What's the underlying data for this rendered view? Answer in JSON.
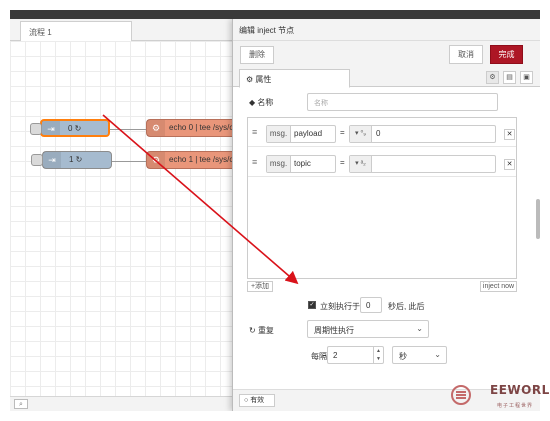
{
  "workspace": {
    "tab_label": "流程 1",
    "search_icon": "search-icon",
    "nodes": [
      {
        "label": "0 ↻",
        "type": "inject",
        "selected": true
      },
      {
        "label": "1 ↻",
        "type": "inject",
        "selected": false
      },
      {
        "label": "echo 0 | tee /sys/c",
        "type": "exec"
      },
      {
        "label": "echo 1 | tee /sys/c",
        "type": "exec"
      }
    ]
  },
  "tray": {
    "title": "编辑 inject 节点",
    "delete_label": "删除",
    "cancel_label": "取消",
    "done_label": "完成",
    "tab_properties": "属性",
    "name_label": "名称",
    "name_placeholder": "名称",
    "props": [
      {
        "msg_prefix": "msg.",
        "key": "payload",
        "op": "=",
        "type_icon": "⁰₉",
        "value": "0"
      },
      {
        "msg_prefix": "msg.",
        "key": "topic",
        "op": "=",
        "type_icon": "ᵃ₂",
        "value": ""
      }
    ],
    "add_label": "添加",
    "inject_now_label": "inject now",
    "inject_once_label": "立刻执行于",
    "inject_once_delay": "0",
    "inject_once_suffix": "秒后, 此后",
    "repeat_label": "重复",
    "repeat_option": "周期性执行",
    "interval_label": "每隔",
    "interval_value": "2",
    "interval_unit": "秒",
    "enabled_label": "有效"
  },
  "watermark": {
    "brand": "EEWORLD",
    "sub": "电子工程世界"
  },
  "colors": {
    "done_button": "#ad1625",
    "inject_node": "#a6bbcf",
    "exec_node": "#e9967a",
    "annotation_arrow": "#d9121a"
  }
}
